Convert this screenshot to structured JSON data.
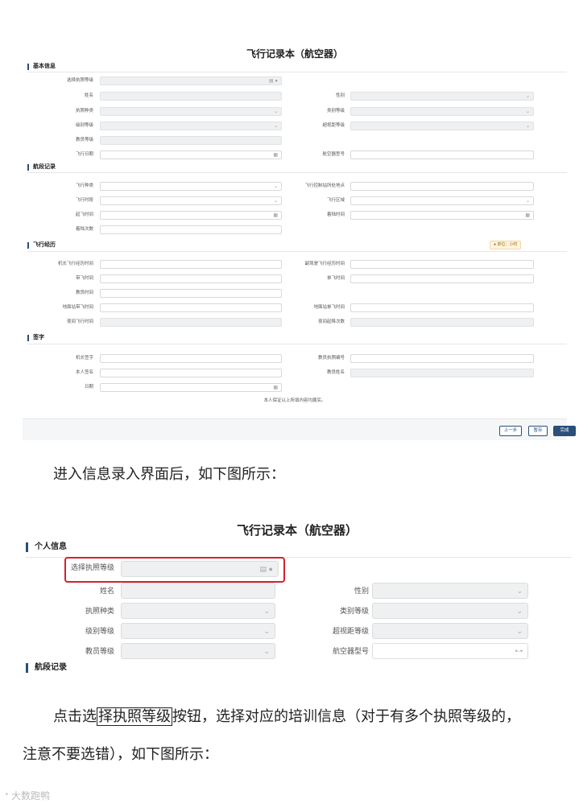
{
  "shot1": {
    "title": "飞行记录本（航空器）",
    "sections": {
      "basic": "基本信息",
      "leg": "航段记录",
      "exp": "飞行经历",
      "sign": "签字"
    },
    "basic_fields": {
      "license_level": "选择执照等级",
      "name": "姓名",
      "gender": "性别",
      "license_type": "执照种类",
      "class_level": "类别等级",
      "grade_level": "级别等级",
      "over_range": "超视距等级",
      "instructor_level": "教员等级",
      "flight_date": "飞行日期",
      "aircraft_model": "航空器型号"
    },
    "leg_fields": {
      "flight_type": "飞行种类",
      "airport": "飞行控制站所处地点",
      "flight_period": "飞行时段",
      "flight_area": "飞行区域",
      "takeoff_time": "起飞时间",
      "landing_time": "着陆时间",
      "landing_count": "着陆次数"
    },
    "exp_badge": "单位：小时",
    "exp_fields": {
      "captain_time": "机长飞行经历时间",
      "copilot_time": "副驾驶飞行经历时间",
      "solo_time": "单飞时间",
      "dual_time": "带飞时间",
      "instructor_time": "教员时间",
      "sim_solo": "地面站单飞时间",
      "sim_dual": "地面站带飞时间",
      "night_time": "夜间飞行时间",
      "night_landing": "夜间起降次数"
    },
    "sign_fields": {
      "captain_sign": "机长签字",
      "instructor_license": "教员执照编号",
      "self_sign": "本人签名",
      "instructor_name": "教员姓名",
      "date": "日期"
    },
    "note": "本人保证以上所填内容均属实。",
    "buttons": {
      "prev": "上一步",
      "save": "暂存",
      "finish": "完成"
    }
  },
  "para1": "进入信息录入界面后，如下图所示：",
  "shot2": {
    "title": "飞行记录本（航空器）",
    "section_personal": "个人信息",
    "section_leg": "航段记录",
    "fields": {
      "license_level": "选择执照等级",
      "name": "姓名",
      "gender": "性别",
      "license_type": "执照种类",
      "class_level": "类别等级",
      "grade_level": "级别等级",
      "over_range": "超视距等级",
      "instructor_level": "教员等级",
      "aircraft_model": "航空器型号"
    }
  },
  "para2": {
    "before": "点击选",
    "highlight": "择执照等级",
    "after": "按钮，选择对应的培训信息（对于有多个执照等级的，",
    "line2": "注意不要选错），如下图所示："
  },
  "watermark": "大数跑鸭"
}
